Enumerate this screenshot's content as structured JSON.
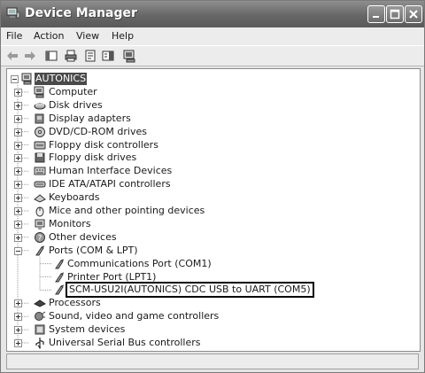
{
  "window": {
    "title": "Device Manager",
    "controls": [
      "minimize",
      "maximize",
      "close"
    ]
  },
  "menubar": {
    "items": [
      {
        "label": "File"
      },
      {
        "label": "Action"
      },
      {
        "label": "View"
      },
      {
        "label": "Help"
      }
    ]
  },
  "toolbar": {
    "buttons": [
      "back-icon",
      "forward-icon",
      "properties-pane-icon",
      "print-icon",
      "properties-icon",
      "help-pane-icon",
      "scan-hardware-icon"
    ]
  },
  "tree": {
    "root": {
      "label": "AUTONICS",
      "icon": "computer-icon"
    },
    "nodes": [
      {
        "label": "Computer",
        "icon": "computer-icon",
        "expanded": false
      },
      {
        "label": "Disk drives",
        "icon": "disk-drive-icon",
        "expanded": false
      },
      {
        "label": "Display adapters",
        "icon": "display-adapter-icon",
        "expanded": false
      },
      {
        "label": "DVD/CD-ROM drives",
        "icon": "dvd-icon",
        "expanded": false
      },
      {
        "label": "Floppy disk controllers",
        "icon": "floppy-controller-icon",
        "expanded": false
      },
      {
        "label": "Floppy disk drives",
        "icon": "floppy-drive-icon",
        "expanded": false
      },
      {
        "label": "Human Interface Devices",
        "icon": "hid-icon",
        "expanded": false
      },
      {
        "label": "IDE ATA/ATAPI controllers",
        "icon": "ide-controller-icon",
        "expanded": false
      },
      {
        "label": "Keyboards",
        "icon": "keyboard-icon",
        "expanded": false
      },
      {
        "label": "Mice and other pointing devices",
        "icon": "mouse-icon",
        "expanded": false
      },
      {
        "label": "Monitors",
        "icon": "monitor-icon",
        "expanded": false
      },
      {
        "label": "Other devices",
        "icon": "other-devices-icon",
        "expanded": false
      },
      {
        "label": "Ports (COM & LPT)",
        "icon": "port-icon",
        "expanded": true,
        "children": [
          {
            "label": "Communications Port (COM1)",
            "icon": "port-icon"
          },
          {
            "label": "Printer Port (LPT1)",
            "icon": "port-icon"
          },
          {
            "label": "SCM-USU2I(AUTONICS) CDC USB to UART (COM5)",
            "icon": "port-icon",
            "highlighted": true
          }
        ]
      },
      {
        "label": "Processors",
        "icon": "processor-icon",
        "expanded": false
      },
      {
        "label": "Sound, video and game controllers",
        "icon": "sound-icon",
        "expanded": false
      },
      {
        "label": "System devices",
        "icon": "system-device-icon",
        "expanded": false
      },
      {
        "label": "Universal Serial Bus controllers",
        "icon": "usb-icon",
        "expanded": false
      }
    ]
  },
  "colors": {
    "title_bar": "#676767",
    "highlight_border": "#000000",
    "root_selection": "#4a4a4a"
  }
}
